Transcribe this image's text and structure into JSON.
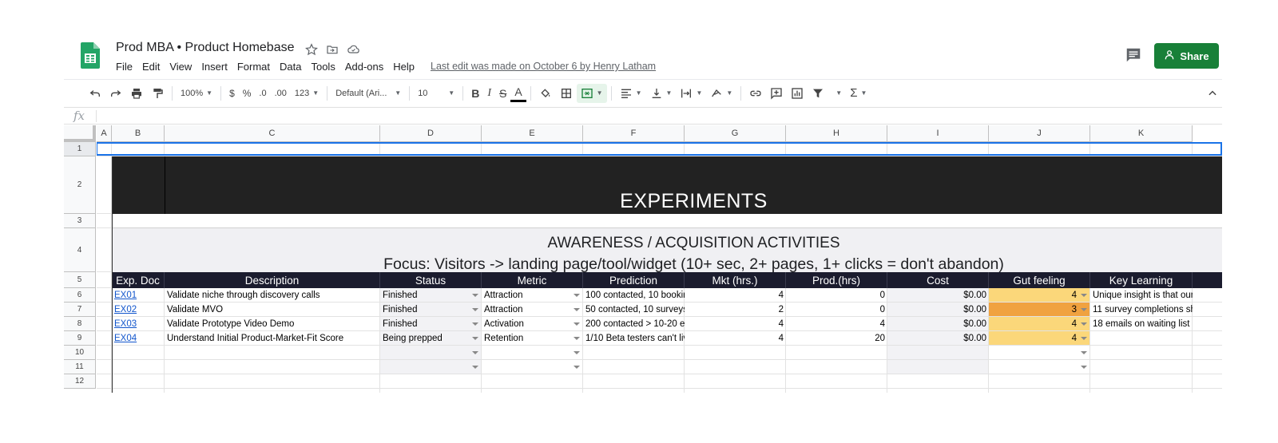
{
  "app": {
    "doc_title": "Prod MBA • Product Homebase",
    "share_label": "Share",
    "last_edit": "Last edit was made on October 6 by Henry Latham"
  },
  "menu": [
    "File",
    "Edit",
    "View",
    "Insert",
    "Format",
    "Data",
    "Tools",
    "Add-ons",
    "Help"
  ],
  "toolbar": {
    "zoom": "100%",
    "currency": "$",
    "percent": "%",
    "dec_decrease": ".0",
    "dec_increase": ".00",
    "more_formats": "123",
    "font": "Default (Ari...",
    "font_size": "10",
    "bold": "B",
    "italic": "I",
    "strike": "S",
    "text_color": "A"
  },
  "formula_bar": {
    "fx": "fx",
    "value": ""
  },
  "columns": [
    "A",
    "B",
    "C",
    "D",
    "E",
    "F",
    "G",
    "H",
    "I",
    "J",
    "K"
  ],
  "rows": [
    "1",
    "2",
    "3",
    "4",
    "5",
    "6",
    "7",
    "8",
    "9",
    "10",
    "11",
    "12"
  ],
  "sheet": {
    "title": "EXPERIMENTS",
    "section_title": "AWARENESS / ACQUISITION ACTIVITIES",
    "focus": "Focus: Visitors -> landing page/tool/widget  (10+ sec, 2+ pages, 1+ clicks = don't abandon)",
    "headers": [
      "Exp. Doc",
      "Description",
      "Status",
      "Metric",
      "Prediction",
      "Mkt (hrs.)",
      "Prod.(hrs)",
      "Cost",
      "Gut feeling",
      "Key Learning"
    ],
    "rows": [
      {
        "doc": "EX01",
        "desc": "Validate niche through discovery calls",
        "status": "Finished",
        "metric": "Attraction",
        "prediction": "100 contacted, 10 bookin",
        "mkt": "4",
        "prod": "0",
        "cost": "$0.00",
        "gut": "4",
        "learning": "Unique insight is that our"
      },
      {
        "doc": "EX02",
        "desc": "Validate MVO",
        "status": "Finished",
        "metric": "Attraction",
        "prediction": "50 contacted, 10 surveys",
        "mkt": "2",
        "prod": "0",
        "cost": "$0.00",
        "gut": "3",
        "learning": "11 survey completions sh"
      },
      {
        "doc": "EX03",
        "desc": "Validate Prototype Video Demo",
        "status": "Finished",
        "metric": "Activation",
        "prediction": "200 contacted > 10-20 er",
        "mkt": "4",
        "prod": "4",
        "cost": "$0.00",
        "gut": "4",
        "learning": "18 emails on waiting list a"
      },
      {
        "doc": "EX04",
        "desc": "Understand Initial Product-Market-Fit Score",
        "status": "Being prepped",
        "metric": "Retention",
        "prediction": "1/10 Beta testers can't liv",
        "mkt": "4",
        "prod": "20",
        "cost": "$0.00",
        "gut": "4",
        "learning": ""
      }
    ]
  },
  "colors": {
    "dark_band": "#222222",
    "header_row": "#1b1c2e",
    "gut_light": "#fbd77a",
    "gut_dark": "#f0a240",
    "share_green": "#188038",
    "selection": "#1a73e8"
  }
}
